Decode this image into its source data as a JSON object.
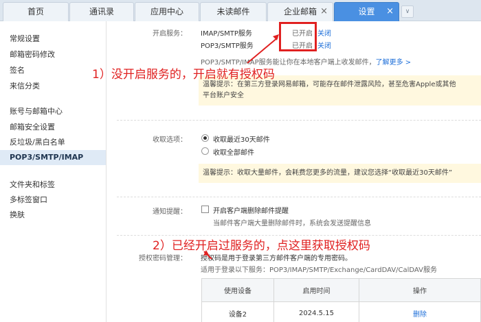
{
  "tabs": [
    {
      "label": "首页"
    },
    {
      "label": "通讯录"
    },
    {
      "label": "应用中心"
    },
    {
      "label": "未读邮件"
    },
    {
      "label": "企业邮箱"
    },
    {
      "label": "设置"
    }
  ],
  "tab_close": "×",
  "tab_more": "∨",
  "sidebar": {
    "items": [
      {
        "label": "常规设置"
      },
      {
        "label": "邮箱密码修改"
      },
      {
        "label": "签名"
      },
      {
        "label": "来信分类"
      },
      {
        "label": "账号与邮箱中心"
      },
      {
        "label": "邮箱安全设置"
      },
      {
        "label": "反垃圾/黑白名单"
      },
      {
        "label": "POP3/SMTP/IMAP"
      },
      {
        "label": "文件夹和标签"
      },
      {
        "label": "多标签窗口"
      },
      {
        "label": "换肤"
      }
    ]
  },
  "service": {
    "label": "开启服务：",
    "rows": [
      {
        "name": "IMAP/SMTP服务",
        "status": "已开启",
        "action": "关闭"
      },
      {
        "name": "POP3/SMTP服务",
        "status": "已开启",
        "action": "关闭"
      }
    ],
    "desc": "POP3/SMTP/IMAP服务能让你在本地客户端上收发邮件，",
    "learn_more": "了解更多 >",
    "warning_line1": "温馨提示：在第三方登录网易邮箱，可能存在邮件泄露风险，甚至危害Apple或其他",
    "warning_line2": "平台账户安全"
  },
  "receive": {
    "label": "收取选项：",
    "options": [
      {
        "label": "收取最近30天邮件",
        "selected": true
      },
      {
        "label": "收取全部邮件",
        "selected": false
      }
    ],
    "hint": "温馨提示：收取大量邮件，会耗费您更多的流量，建议您选择“收取最近30天邮件”"
  },
  "notify": {
    "label": "通知提醒：",
    "checkbox_label": "开启客户端删除邮件提醒",
    "checked": false,
    "sub": "当邮件客户端大量删除邮件时，系统会发送提醒信息"
  },
  "auth": {
    "label": "授权密码管理：",
    "desc1": "授权码是用于登录第三方邮件客户端的专用密码。",
    "desc2": "适用于登录以下服务：POP3/IMAP/SMTP/Exchange/CardDAV/CalDAV服务",
    "table": {
      "headers": [
        "使用设备",
        "启用时间",
        "操作"
      ],
      "rows": [
        [
          "设备2",
          "2024.5.15",
          "删除"
        ]
      ]
    }
  },
  "annotations": {
    "a1": "1）没开启服务的，开启就有授权码",
    "a2": "2）已经开启过服务的，点这里获取授权码"
  },
  "colors": {
    "active_tab": "#4a90e2",
    "annotation_red": "#e02020",
    "link": "#1e6fd9",
    "hint_bg": "#fff8df"
  }
}
